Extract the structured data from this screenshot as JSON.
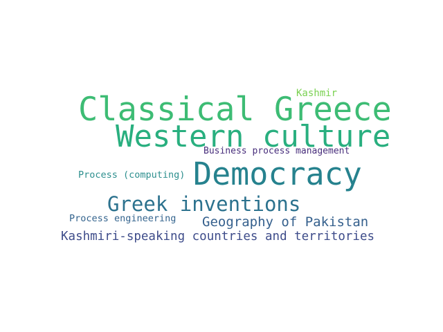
{
  "words": [
    {
      "text": "Kashmir",
      "color": "#7ad151"
    },
    {
      "text": "Classical Greece",
      "color": "#3dbc74"
    },
    {
      "text": "Western culture",
      "color": "#29af7f"
    },
    {
      "text": "Business process management",
      "color": "#472d7b"
    },
    {
      "text": "Process (computing)",
      "color": "#2d8f8e"
    },
    {
      "text": "Democracy",
      "color": "#26828e"
    },
    {
      "text": "Greek inventions",
      "color": "#2c728e"
    },
    {
      "text": "Process engineering",
      "color": "#33638d"
    },
    {
      "text": "Geography of Pakistan",
      "color": "#35608d"
    },
    {
      "text": "Kashmiri-speaking countries and territories",
      "color": "#3e4c8a"
    }
  ]
}
